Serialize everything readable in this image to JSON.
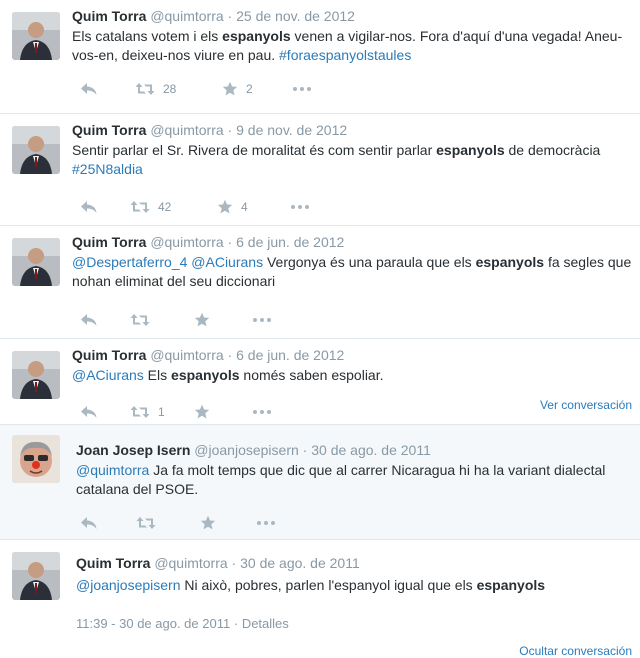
{
  "tweets": [
    {
      "fullname": "Quim Torra",
      "screen": "@quimtorra",
      "sep": "·",
      "date": "25 de nov. de 2012",
      "parts": [
        {
          "t": "Els catalans votem i els ",
          "s": "n"
        },
        {
          "t": "espanyols",
          "s": "b"
        },
        {
          "t": " venen a vigilar-nos. Fora d'aquí d'una vegada! Aneu-vos-en, deixeu-nos viure en pau. ",
          "s": "n"
        },
        {
          "t": "#foraespanyolstaules",
          "s": "l"
        }
      ],
      "retweets": "28",
      "favorites": "2"
    },
    {
      "fullname": "Quim Torra",
      "screen": "@quimtorra",
      "sep": "·",
      "date": "9 de nov. de 2012",
      "parts": [
        {
          "t": "Sentir parlar el Sr. Rivera de moralitat és com sentir parlar ",
          "s": "n"
        },
        {
          "t": "espanyols",
          "s": "b"
        },
        {
          "t": " de democràcia ",
          "s": "n"
        },
        {
          "t": "#25N8aldia",
          "s": "l"
        }
      ],
      "retweets": "42",
      "favorites": "4"
    },
    {
      "fullname": "Quim Torra",
      "screen": "@quimtorra",
      "sep": "·",
      "date": "6 de jun. de 2012",
      "parts": [
        {
          "t": "@Despertaferro_4",
          "s": "l"
        },
        {
          "t": " ",
          "s": "n"
        },
        {
          "t": "@ACiurans",
          "s": "l"
        },
        {
          "t": " Vergonya és una paraula que els ",
          "s": "n"
        },
        {
          "t": "espanyols",
          "s": "b"
        },
        {
          "t": " fa segles que nohan eliminat del seu diccionari",
          "s": "n"
        }
      ],
      "retweets": "",
      "favorites": ""
    },
    {
      "fullname": "Quim Torra",
      "screen": "@quimtorra",
      "sep": "·",
      "date": "6 de jun. de 2012",
      "parts": [
        {
          "t": "@ACiurans",
          "s": "l"
        },
        {
          "t": " Els ",
          "s": "n"
        },
        {
          "t": "espanyols",
          "s": "b"
        },
        {
          "t": " només saben espoliar.",
          "s": "n"
        }
      ],
      "retweets": "1",
      "favorites": "",
      "conversation": "Ver conversación"
    },
    {
      "fullname": "Joan Josep Isern",
      "screen": "@joanjosepisern",
      "sep": "·",
      "date": "30 de ago. de 2011",
      "parts": [
        {
          "t": "@quimtorra",
          "s": "l"
        },
        {
          "t": " Ja fa molt temps que dic que al carrer Nicaragua hi ha la variant dialectal catalana del PSOE.",
          "s": "n"
        }
      ],
      "retweets": "",
      "favorites": ""
    },
    {
      "fullname": "Quim Torra",
      "screen": "@quimtorra",
      "sep": "·",
      "date": "30 de ago. de 2011",
      "parts": [
        {
          "t": "@joanjosepisern",
          "s": "l"
        },
        {
          "t": " Ni això, pobres, parlen l'espanyol igual que els ",
          "s": "n"
        },
        {
          "t": "espanyols",
          "s": "b"
        }
      ],
      "timestamp": "11:39 - 30 de ago. de 2011",
      "details_sep": "·",
      "details": "Detalles",
      "conversation": "Ocultar conversación"
    }
  ],
  "colors": {
    "link": "#2b7bb9",
    "muted": "#8899a6",
    "icon": "#aab8c2",
    "highlight_bg": "#f5f8fa"
  },
  "icons": [
    "reply-icon",
    "retweet-icon",
    "favorite-icon",
    "more-icon"
  ]
}
